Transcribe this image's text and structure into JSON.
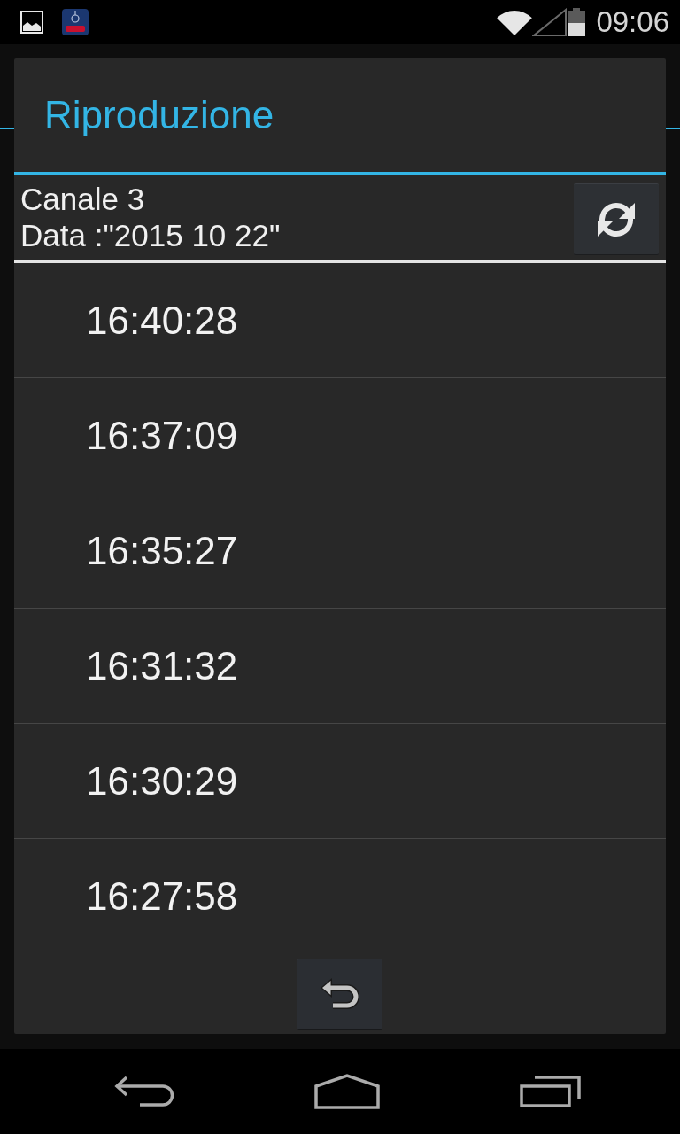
{
  "status_bar": {
    "time": "09:06"
  },
  "dialog": {
    "title": "Riproduzione",
    "channel": "Canale 3",
    "date": "Data :\"2015 10 22\"",
    "times": [
      "16:40:28",
      "16:37:09",
      "16:35:27",
      "16:31:32",
      "16:30:29",
      "16:27:58"
    ]
  }
}
